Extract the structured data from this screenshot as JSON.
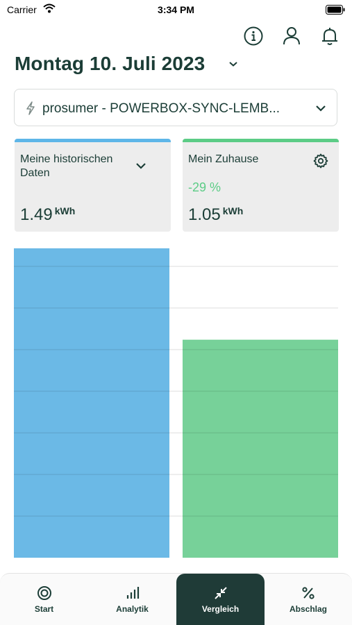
{
  "status_bar": {
    "carrier": "Carrier",
    "time": "3:34 PM"
  },
  "header": {
    "icons": [
      "info-icon",
      "user-icon",
      "bell-icon"
    ],
    "date": "Montag 10. Juli 2023"
  },
  "device_select": {
    "label": "prosumer - POWERBOX-SYNC-LEMB..."
  },
  "cards": {
    "historic": {
      "title": "Meine historischen Daten",
      "value": "1.49",
      "unit": "kWh",
      "accent": "#5eb6e8"
    },
    "home": {
      "title": "Mein Zuhause",
      "delta": "-29 %",
      "value": "1.05",
      "unit": "kWh",
      "accent": "#5ccc86"
    }
  },
  "chart_data": {
    "type": "bar",
    "categories": [
      "Meine historischen Daten",
      "Mein Zuhause"
    ],
    "values": [
      1.49,
      1.05
    ],
    "colors": [
      "#6bb9e6",
      "#77d199"
    ],
    "grid": true,
    "ylim": [
      0,
      1.49
    ]
  },
  "tabs": [
    {
      "label": "Start",
      "icon": "start-icon",
      "active": false
    },
    {
      "label": "Analytik",
      "icon": "analytics-icon",
      "active": false
    },
    {
      "label": "Vergleich",
      "icon": "compare-icon",
      "active": true
    },
    {
      "label": "Abschlag",
      "icon": "percent-icon",
      "active": false
    }
  ]
}
